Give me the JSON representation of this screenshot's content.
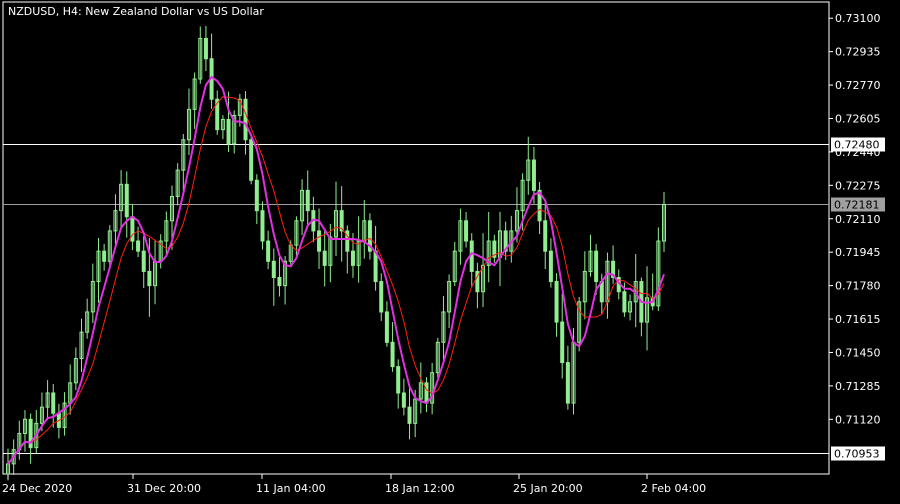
{
  "title": "NZDUSD, H4:  New Zealand Dollar vs US Dollar",
  "colors": {
    "background": "#000000",
    "frame": "#ffffff",
    "candle": "#90ee90",
    "ma_fast": "#e030e0",
    "ma_slow": "#ff2010",
    "hline": "#ffffff",
    "hline_mid": "#a0a0a0",
    "label_bg_highlight": "#ffffff",
    "label_fg_highlight": "#000000"
  },
  "chart_data": {
    "type": "candlestick",
    "symbol": "NZDUSD",
    "timeframe": "H4",
    "ylim": [
      0.7085,
      0.7318
    ],
    "price_ticks": [
      "0.73100",
      "0.72935",
      "0.72770",
      "0.72605",
      "0.72440",
      "0.72275",
      "0.72110",
      "0.71945",
      "0.71780",
      "0.71615",
      "0.71450",
      "0.71285",
      "0.71120"
    ],
    "time_ticks": [
      "24 Dec 2020",
      "31 Dec 20:00",
      "11 Jan 04:00",
      "18 Jan 12:00",
      "25 Jan 20:00",
      "2 Feb 04:00"
    ],
    "horizontal_levels": [
      {
        "label": "0.72480",
        "value": 0.7248,
        "style": "boxed"
      },
      {
        "label": "0.72181",
        "value": 0.72181,
        "style": "grey"
      },
      {
        "label": "0.70953",
        "value": 0.70953,
        "style": "boxed"
      }
    ],
    "close_series": [
      0.709,
      0.7097,
      0.7105,
      0.7112,
      0.7098,
      0.711,
      0.7118,
      0.7125,
      0.7115,
      0.7108,
      0.712,
      0.713,
      0.7142,
      0.7155,
      0.7165,
      0.718,
      0.7195,
      0.719,
      0.7205,
      0.7215,
      0.7228,
      0.7212,
      0.72,
      0.7195,
      0.7185,
      0.7178,
      0.719,
      0.72,
      0.721,
      0.7222,
      0.7235,
      0.725,
      0.7265,
      0.728,
      0.73,
      0.729,
      0.727,
      0.7255,
      0.726,
      0.7248,
      0.7262,
      0.727,
      0.725,
      0.723,
      0.7215,
      0.72,
      0.719,
      0.7182,
      0.7178,
      0.719,
      0.7198,
      0.721,
      0.7225,
      0.7215,
      0.7205,
      0.7195,
      0.7188,
      0.7202,
      0.7215,
      0.7205,
      0.7195,
      0.7188,
      0.72,
      0.721,
      0.7195,
      0.718,
      0.7165,
      0.715,
      0.7138,
      0.7125,
      0.7118,
      0.711,
      0.7122,
      0.713,
      0.712,
      0.7135,
      0.715,
      0.7165,
      0.718,
      0.7195,
      0.721,
      0.72,
      0.7185,
      0.7175,
      0.7188,
      0.72,
      0.7192,
      0.7205,
      0.7195,
      0.7205,
      0.7215,
      0.723,
      0.724,
      0.7225,
      0.721,
      0.7195,
      0.718,
      0.716,
      0.714,
      0.712,
      0.715,
      0.717,
      0.7185,
      0.7195,
      0.718,
      0.717,
      0.719,
      0.7182,
      0.7175,
      0.7165,
      0.717,
      0.718,
      0.716,
      0.7172,
      0.7168,
      0.72,
      0.7218
    ]
  }
}
